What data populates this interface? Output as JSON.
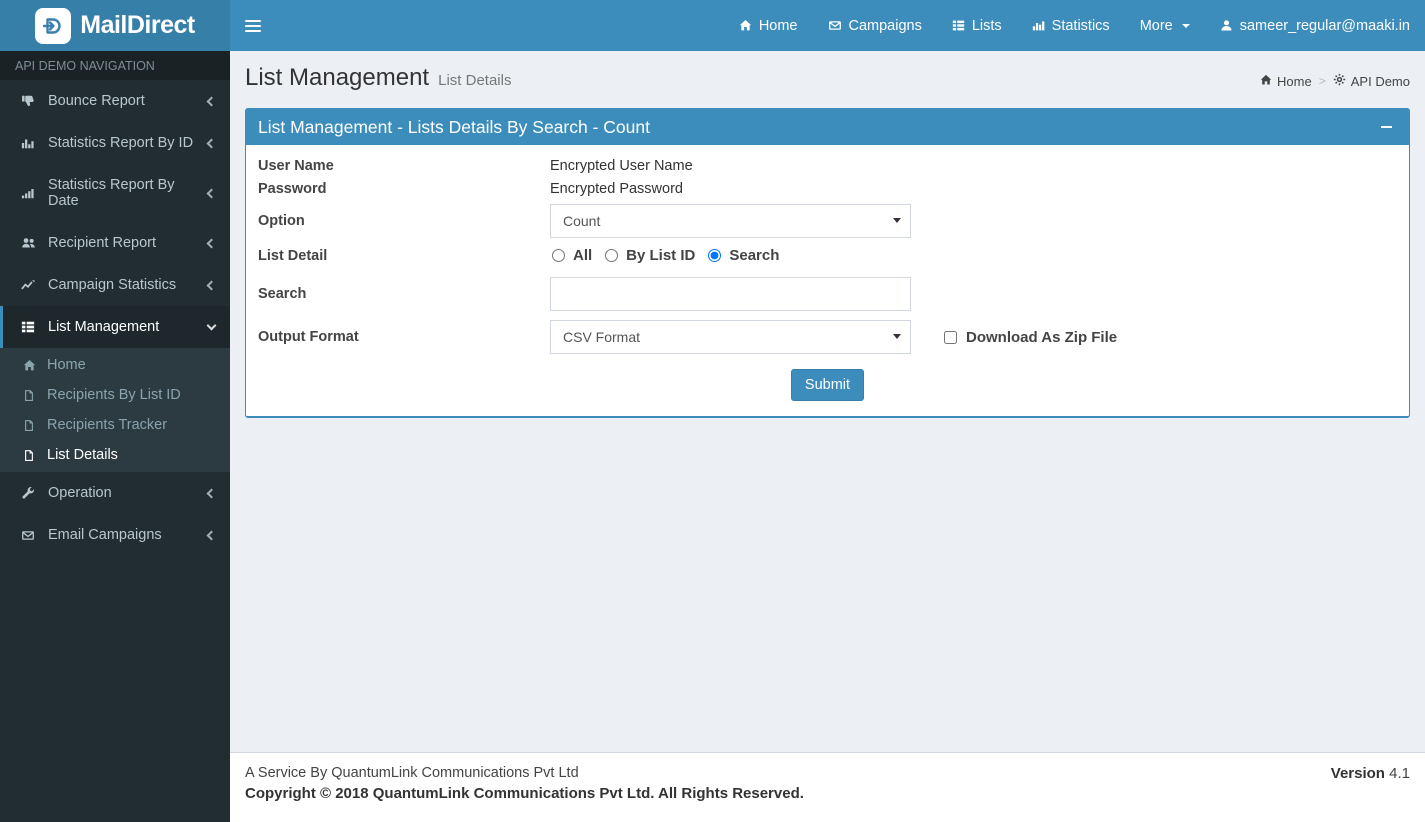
{
  "colors": {
    "navbar": "#3c8dbc",
    "logo_bg": "#367fa9",
    "sidebar_bg": "#222d32",
    "submenu_bg": "#2c3b41",
    "content_bg": "#ecf0f5",
    "panel_accent": "#3c8dbc"
  },
  "brand": {
    "logo_text": "MailDirect"
  },
  "navbar": {
    "items": [
      {
        "label": "Home",
        "icon": "home-icon"
      },
      {
        "label": "Campaigns",
        "icon": "envelope-icon"
      },
      {
        "label": "Lists",
        "icon": "list-icon"
      },
      {
        "label": "Statistics",
        "icon": "bar-chart-icon"
      },
      {
        "label": "More",
        "icon": "caret-down-icon"
      },
      {
        "label": "sameer_regular@maaki.in",
        "icon": "user-icon"
      }
    ]
  },
  "sidebar": {
    "header": "API DEMO NAVIGATION",
    "items": [
      {
        "label": "Bounce Report",
        "icon": "thumbs-down-icon",
        "expanded": false
      },
      {
        "label": "Statistics Report By ID",
        "icon": "bar-chart-icon",
        "expanded": false
      },
      {
        "label": "Statistics Report By Date",
        "icon": "signal-icon",
        "expanded": false
      },
      {
        "label": "Recipient Report",
        "icon": "users-icon",
        "expanded": false
      },
      {
        "label": "Campaign Statistics",
        "icon": "line-chart-icon",
        "expanded": false
      },
      {
        "label": "List Management",
        "icon": "list-icon",
        "expanded": true
      },
      {
        "label": "Operation",
        "icon": "wrench-icon",
        "expanded": false
      },
      {
        "label": "Email Campaigns",
        "icon": "envelope-icon",
        "expanded": false
      }
    ],
    "list_management_children": [
      {
        "label": "Home",
        "icon": "home-icon",
        "active": false
      },
      {
        "label": "Recipients By List ID",
        "icon": "file-icon",
        "active": false
      },
      {
        "label": "Recipients Tracker",
        "icon": "file-icon",
        "active": false
      },
      {
        "label": "List Details",
        "icon": "file-icon",
        "active": true
      }
    ]
  },
  "page": {
    "title": "List Management",
    "subtitle": "List Details",
    "breadcrumb": [
      {
        "label": "Home",
        "icon": "home-icon"
      },
      {
        "label": "API Demo",
        "icon": "gear-icon"
      }
    ]
  },
  "panel": {
    "title": "List Management - Lists Details By Search - Count"
  },
  "form": {
    "user_name": {
      "label": "User Name",
      "value": "Encrypted User Name"
    },
    "password": {
      "label": "Password",
      "value": "Encrypted Password"
    },
    "option": {
      "label": "Option",
      "selected": "Count"
    },
    "list_detail": {
      "label": "List Detail",
      "options": [
        {
          "label": "All",
          "checked": false
        },
        {
          "label": "By List ID",
          "checked": false
        },
        {
          "label": "Search",
          "checked": true
        }
      ]
    },
    "search": {
      "label": "Search",
      "value": "",
      "placeholder": ""
    },
    "output_format": {
      "label": "Output Format",
      "selected": "CSV Format"
    },
    "zip": {
      "label": "Download As Zip File",
      "checked": false
    },
    "submit_label": "Submit"
  },
  "footer": {
    "line1": "A Service By QuantumLink Communications Pvt Ltd",
    "line2": "Copyright © 2018 QuantumLink Communications Pvt Ltd. All Rights Reserved.",
    "version_label": "Version",
    "version_value": "4.1"
  }
}
